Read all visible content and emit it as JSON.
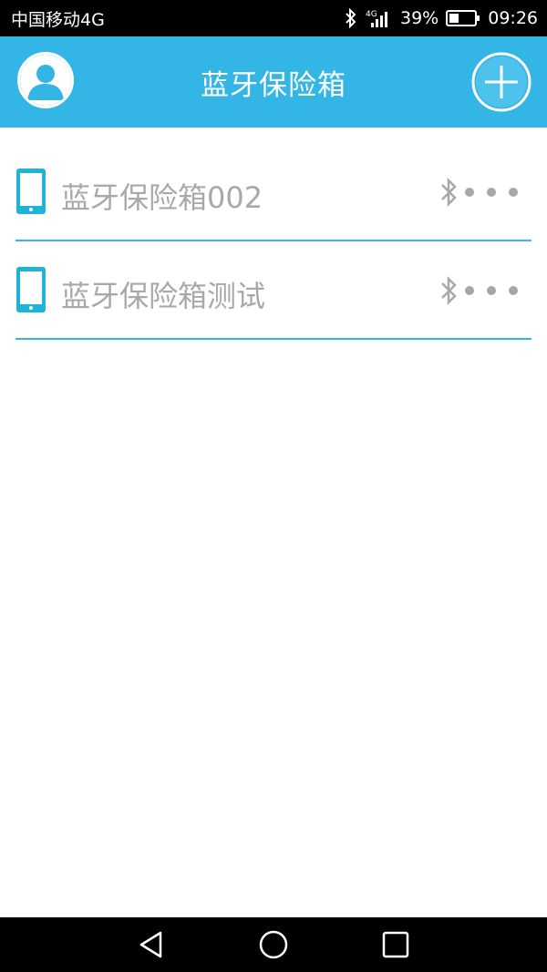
{
  "status_bar": {
    "carrier": "中国移动4G",
    "network": "4G",
    "battery_percent": "39%",
    "time": "09:26",
    "battery_level": 0.39
  },
  "header": {
    "title": "蓝牙保险箱",
    "avatar_icon": "user-avatar-icon",
    "add_icon": "plus-circle-icon"
  },
  "devices": [
    {
      "name": "蓝牙保险箱002",
      "icon": "tablet-icon",
      "status_icon": "bluetooth-icon",
      "menu_icon": "more-dots-icon"
    },
    {
      "name": "蓝牙保险箱测试",
      "icon": "tablet-icon",
      "status_icon": "bluetooth-icon",
      "menu_icon": "more-dots-icon"
    }
  ],
  "nav": {
    "back_icon": "back-triangle-icon",
    "home_icon": "home-circle-icon",
    "recents_icon": "recents-square-icon"
  },
  "colors": {
    "accent": "#33b5e5",
    "text_gray": "#a8a8a8",
    "status_bg": "#000000"
  }
}
